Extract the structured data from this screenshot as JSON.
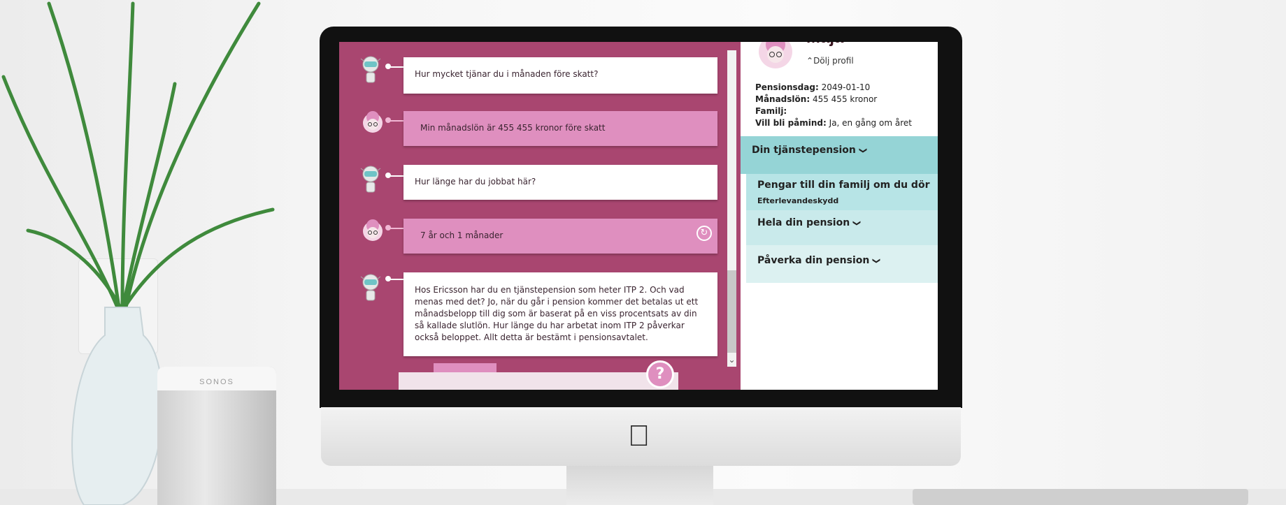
{
  "chat": {
    "messages": [
      {
        "role": "bot",
        "text": "Hur mycket tjänar du i månaden före skatt?"
      },
      {
        "role": "user",
        "text": "Min månadslön är 455 455 kronor före skatt"
      },
      {
        "role": "bot",
        "text": "Hur länge har du jobbat här?"
      },
      {
        "role": "user",
        "text": "7 år och 1 månader"
      },
      {
        "role": "bot",
        "text": "Hos Ericsson har du en tjänstepension som heter ITP 2. Och vad menas med det? Jo, när du går i pension kommer det betalas ut ett månadsbelopp till dig som är baserat på en viss procentsats av din så kallade slutlön. Hur länge du har arbetat inom ITP 2 påverkar också beloppet. Allt detta är bestämt i pensionsavtalet."
      }
    ],
    "help_label": "?",
    "refresh_icon": "refresh-icon"
  },
  "profile": {
    "name": "Maja",
    "hide_label": "Dölj profil",
    "facts": [
      {
        "label": "Pensionsdag:",
        "value": "2049-01-10"
      },
      {
        "label": "Månadslön:",
        "value": "455 455 kronor"
      },
      {
        "label": "Familj:",
        "value": ""
      },
      {
        "label": "Vill bli påmind:",
        "value": "Ja, en gång om året"
      }
    ]
  },
  "accordion": {
    "main": "Din tjänstepension",
    "items": [
      {
        "label": "Pengar till din familj om du dör",
        "sub": "Efterlevandeskydd"
      },
      {
        "label": "Hela din pension"
      },
      {
        "label": "Påverka din pension"
      }
    ]
  },
  "device": {
    "speaker_brand": "SONOS"
  },
  "colors": {
    "chat_bg": "#a94670",
    "user_bubble": "#df8fbf",
    "accent_teal": "#95d4d6"
  }
}
